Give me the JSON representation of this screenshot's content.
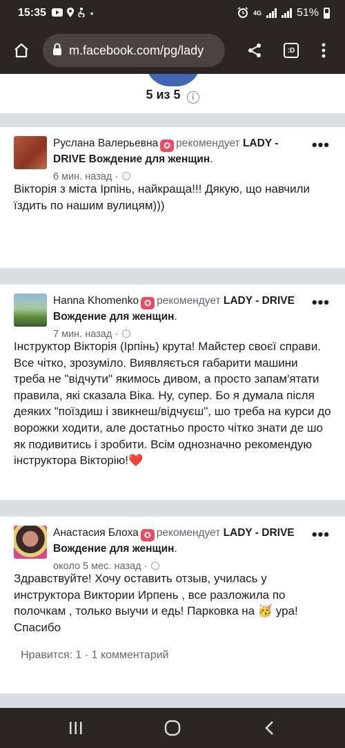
{
  "status_bar": {
    "time": "15:35",
    "battery": "51%",
    "network": "4G"
  },
  "browser": {
    "url": "m.facebook.com/pg/lady"
  },
  "rating": {
    "text": "5 из 5",
    "info_glyph": "i"
  },
  "posts": [
    {
      "author": "Руслана Валерьевна",
      "recommends": "рекомендует",
      "page": "LADY - DRIVE Вождение для женщин",
      "time": "6 мин. назад",
      "text": "Вікторія з міста Ірпінь, найкраща!!! Дякую, що навчили їздить по нашим вулицям)))"
    },
    {
      "author": "Hanna Khomenko",
      "recommends": "рекомендует",
      "page": "LADY - DRIVE Вождение для женщин",
      "time": "7 мин. назад",
      "text": "Інструктор Вікторія (Ірпінь) крута! Майстер своєї справи. Все чітко, зрозуміло. Виявляється габарити машини треба не \"відчути\" якимось дивом, а просто запам'ятати правила, які сказала Віка. Ну, супер. Бо я думала після деяких \"поїздиш і звикнеш/відчуєш\", шо треба на курси до ворожки ходити, але достатньо просто чітко знати де шо як подивитись і зробити. Всім однозначно рекомендую інструктора Вікторію!",
      "emoji": "❤️"
    },
    {
      "author": "Анастасия Блоха",
      "recommends": "рекомендует",
      "page": "LADY - DRIVE Вождение для женщин",
      "time": "около 5 мес. назад",
      "text_before": "Здравствуйте! Хочу оставить отзыв, училась у инструктора Виктории Ирпень , все разложила по полочкам , только выучи и едь! Парковка на",
      "emoji": "🥳",
      "text_after": "ура! Спасибо",
      "reactions": "Нравится: 1 · 1 комментарий"
    }
  ],
  "colors": {
    "facebook_blue": "#4267b2",
    "badge": "#e64d64",
    "chrome_dark": "#2b2624"
  }
}
